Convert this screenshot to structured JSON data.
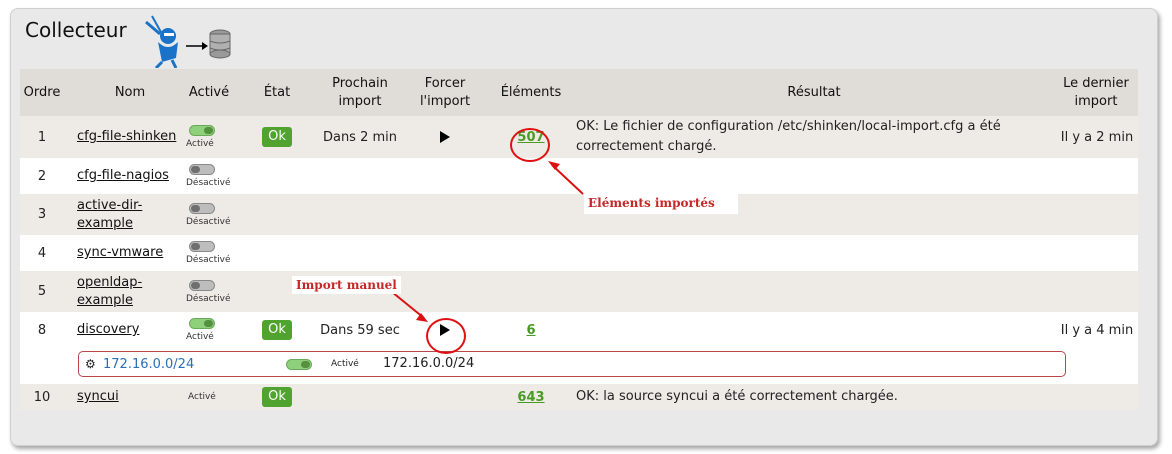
{
  "page": {
    "title": "Collecteur"
  },
  "icons": {
    "title_icon": "shinken-to-database-icon",
    "source_icon": "gears-icon",
    "action_icon": "play-icon"
  },
  "colors": {
    "ok": "#4fa32e",
    "link_green": "#4a9a26",
    "link_blue": "#2a6fb5",
    "annotation": "#c62828"
  },
  "columns": [
    "Ordre",
    "Nom",
    "Activé",
    "État",
    "Prochain import",
    "Forcer l'import",
    "Éléments",
    "Résultat",
    "Le dernier import"
  ],
  "rows": [
    {
      "order": "1",
      "name": "cfg-file-shinken",
      "enabled": true,
      "enabled_label": "Activé",
      "state": "Ok",
      "next_import": "Dans 2 min",
      "force": true,
      "elements": "507",
      "result": "OK: Le fichier de configuration /etc/shinken/local-import.cfg a été correctement chargé.",
      "last_import": "Il y a 2 min"
    },
    {
      "order": "2",
      "name": "cfg-file-nagios",
      "enabled": false,
      "enabled_label": "Désactivé",
      "state": "",
      "next_import": "",
      "force": false,
      "elements": "",
      "result": "",
      "last_import": ""
    },
    {
      "order": "3",
      "name": "active-dir-example",
      "enabled": false,
      "enabled_label": "Désactivé",
      "state": "",
      "next_import": "",
      "force": false,
      "elements": "",
      "result": "",
      "last_import": ""
    },
    {
      "order": "4",
      "name": "sync-vmware",
      "enabled": false,
      "enabled_label": "Désactivé",
      "state": "",
      "next_import": "",
      "force": false,
      "elements": "",
      "result": "",
      "last_import": ""
    },
    {
      "order": "5",
      "name": "openldap-example",
      "enabled": false,
      "enabled_label": "Désactivé",
      "state": "",
      "next_import": "",
      "force": false,
      "elements": "",
      "result": "",
      "last_import": ""
    },
    {
      "order": "8",
      "name": "discovery",
      "enabled": true,
      "enabled_label": "Activé",
      "state": "Ok",
      "next_import": "Dans 59 sec",
      "force": true,
      "elements": "6",
      "result": "",
      "last_import": "Il y a 4 min"
    },
    {
      "order": "10",
      "name": "syncui",
      "enabled": null,
      "enabled_label": "Activé",
      "state": "Ok",
      "next_import": "",
      "force": false,
      "elements": "643",
      "result": "OK: la source syncui a été correctement chargée.",
      "last_import": ""
    }
  ],
  "discovery_sub": {
    "link": "172.16.0.0/24",
    "enabled": true,
    "enabled_label": "Activé",
    "value": "172.16.0.0/24"
  },
  "annotations": {
    "elements": "Eléments importés",
    "manual": "Import manuel"
  }
}
